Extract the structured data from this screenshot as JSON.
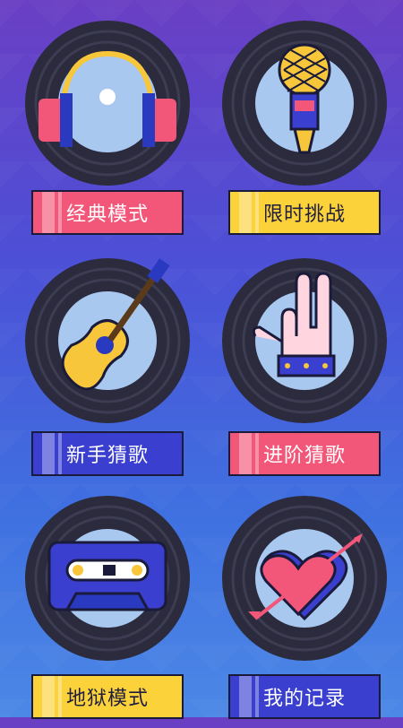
{
  "modes": [
    {
      "label": "经典模式",
      "icon": "headphones-icon",
      "color": "pink"
    },
    {
      "label": "限时挑战",
      "icon": "microphone-icon",
      "color": "yellow"
    },
    {
      "label": "新手猜歌",
      "icon": "guitar-icon",
      "color": "blue"
    },
    {
      "label": "进阶猜歌",
      "icon": "rock-hand-icon",
      "color": "pink"
    },
    {
      "label": "地狱模式",
      "icon": "cassette-icon",
      "color": "yellow"
    },
    {
      "label": "我的记录",
      "icon": "heart-arrow-icon",
      "color": "blue"
    }
  ]
}
